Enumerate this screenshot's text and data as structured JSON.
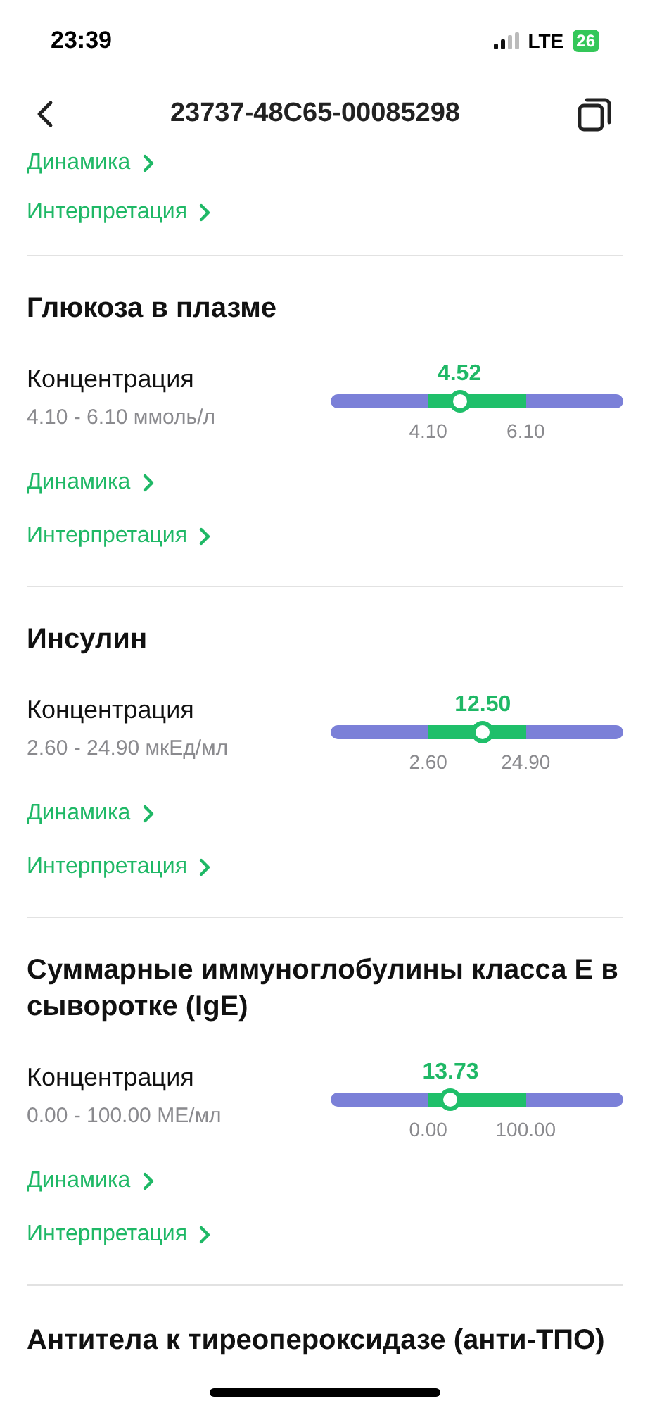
{
  "status_bar": {
    "time": "23:39",
    "network": "LTE",
    "battery": "26"
  },
  "header": {
    "title": "23737-48C65-00085298"
  },
  "previous_links": [
    "Динамика",
    "Интерпретация"
  ],
  "tests": [
    {
      "name": "Глюкоза в плазме",
      "parameter": "Концентрация",
      "range": "4.10 - 6.10 ммоль/л",
      "value": "4.52",
      "low": "4.10",
      "high": "6.10",
      "level": 0.44,
      "links": [
        "Динамика",
        "Интерпретация"
      ]
    },
    {
      "name": "Инсулин",
      "parameter": "Концентрация",
      "range": "2.60 - 24.90 мкЕд/мл",
      "value": "12.50",
      "low": "2.60",
      "high": "24.90",
      "level": 0.52,
      "links": [
        "Динамика",
        "Интерпретация"
      ]
    },
    {
      "name": "Суммарные иммуноглобулины класса E в сыворотке (IgE)",
      "parameter": "Концентрация",
      "range": "0.00 - 100.00 МЕ/мл",
      "value": "13.73",
      "low": "0.00",
      "high": "100.00",
      "level": 0.41,
      "links": [
        "Динамика",
        "Интерпретация"
      ]
    }
  ],
  "next_test": {
    "name": "Антитела к тиреопероксидазе (анти-ТПО)"
  }
}
